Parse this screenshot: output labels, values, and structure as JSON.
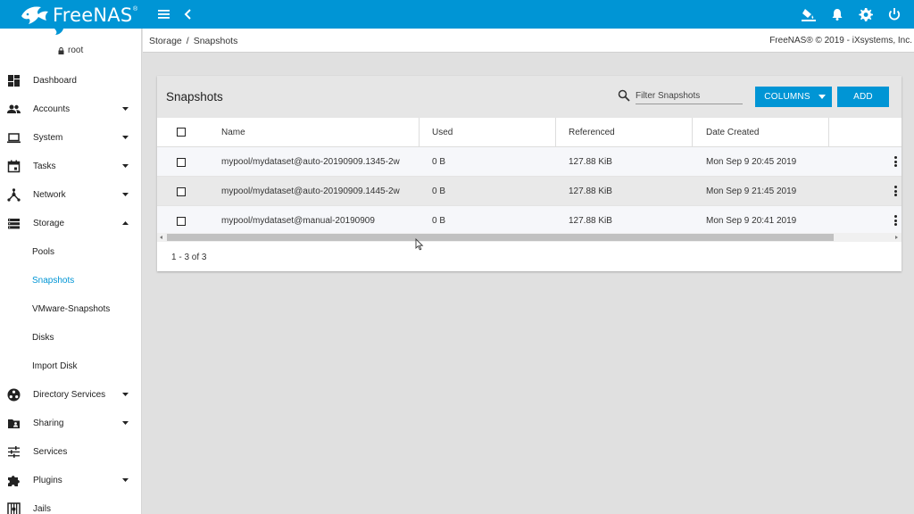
{
  "topbar": {
    "logo_text": "FreeNAS",
    "logo_reg": "®",
    "icons": [
      "menu-icon",
      "back-chevron-icon",
      "theme-icon",
      "bell-icon",
      "gear-icon",
      "power-icon"
    ]
  },
  "user": {
    "name": "root",
    "icon": "lock-icon"
  },
  "sidebar": {
    "items": [
      {
        "label": "Dashboard",
        "icon": "dashboard-icon",
        "caret": false
      },
      {
        "label": "Accounts",
        "icon": "people-icon",
        "caret": "down"
      },
      {
        "label": "System",
        "icon": "laptop-icon",
        "caret": "down"
      },
      {
        "label": "Tasks",
        "icon": "calendar-icon",
        "caret": "down"
      },
      {
        "label": "Network",
        "icon": "network-icon",
        "caret": "down"
      },
      {
        "label": "Storage",
        "icon": "storage-icon",
        "caret": "up"
      },
      {
        "label": "Directory Services",
        "icon": "directory-icon",
        "caret": "down"
      },
      {
        "label": "Sharing",
        "icon": "folder-share-icon",
        "caret": "down"
      },
      {
        "label": "Services",
        "icon": "tune-icon",
        "caret": false
      },
      {
        "label": "Plugins",
        "icon": "puzzle-icon",
        "caret": "down"
      },
      {
        "label": "Jails",
        "icon": "jail-icon",
        "caret": false
      }
    ],
    "storage_sub": [
      {
        "label": "Pools",
        "active": false
      },
      {
        "label": "Snapshots",
        "active": true
      },
      {
        "label": "VMware-Snapshots",
        "active": false
      },
      {
        "label": "Disks",
        "active": false
      },
      {
        "label": "Import Disk",
        "active": false
      }
    ]
  },
  "breadcrumb": {
    "parent": "Storage",
    "sep": "/",
    "current": "Snapshots"
  },
  "copyright": "FreeNAS® © 2019 - iXsystems, Inc.",
  "card": {
    "title": "Snapshots",
    "filter_placeholder": "Filter Snapshots",
    "columns_label": "COLUMNS",
    "add_label": "ADD"
  },
  "table": {
    "headers": [
      "Name",
      "Used",
      "Referenced",
      "Date Created"
    ],
    "rows": [
      {
        "name": "mypool/mydataset@auto-20190909.1345-2w",
        "used": "0 B",
        "referenced": "127.88 KiB",
        "created": "Mon Sep 9 20:45 2019"
      },
      {
        "name": "mypool/mydataset@auto-20190909.1445-2w",
        "used": "0 B",
        "referenced": "127.88 KiB",
        "created": "Mon Sep 9 21:45 2019"
      },
      {
        "name": "mypool/mydataset@manual-20190909",
        "used": "0 B",
        "referenced": "127.88 KiB",
        "created": "Mon Sep 9 20:41 2019"
      }
    ],
    "pager": "1 - 3 of 3"
  },
  "colors": {
    "accent": "#0095d5",
    "active_link": "#0095d5",
    "background": "#e0e0e0"
  }
}
